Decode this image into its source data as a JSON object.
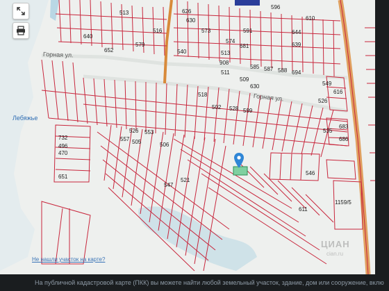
{
  "map": {
    "streets": {
      "gornaya_1": "Горная ул.",
      "gornaya_2": "Горная ул."
    },
    "places": {
      "lebyazhe": "Лебяжье"
    },
    "lots": [
      "513",
      "626",
      "596",
      "640",
      "573",
      "644",
      "516",
      "681",
      "579",
      "591",
      "652",
      "610",
      "540",
      "574",
      "513",
      "908",
      "585",
      "587",
      "588",
      "694",
      "549",
      "616",
      "526",
      "518",
      "502",
      "511",
      "528",
      "599",
      "509",
      "630",
      "732",
      "496",
      "470",
      "553",
      "557",
      "651",
      "505",
      "506",
      "1159/5",
      "526",
      "521",
      "535",
      "546",
      "683",
      "630",
      "639",
      "686",
      "611",
      "547"
    ],
    "colors": {
      "parcel_line": "#c8263c",
      "road": "#d88a3a",
      "water": "#9fc8d8",
      "background": "#eef0ee"
    }
  },
  "ui": {
    "not_found_link": "Не нашли участок на карте?",
    "watermark": "ЦИАН",
    "watermark_sub": "cian.ru",
    "footer_text": "На публичной кадастровой карте (ПКК) вы можете найти любой земельный участок, здание, дом или сооружение, вклю"
  },
  "icons": {
    "fullscreen": "expand-icon",
    "print": "printer-icon",
    "location_pin": "map-pin-icon"
  }
}
